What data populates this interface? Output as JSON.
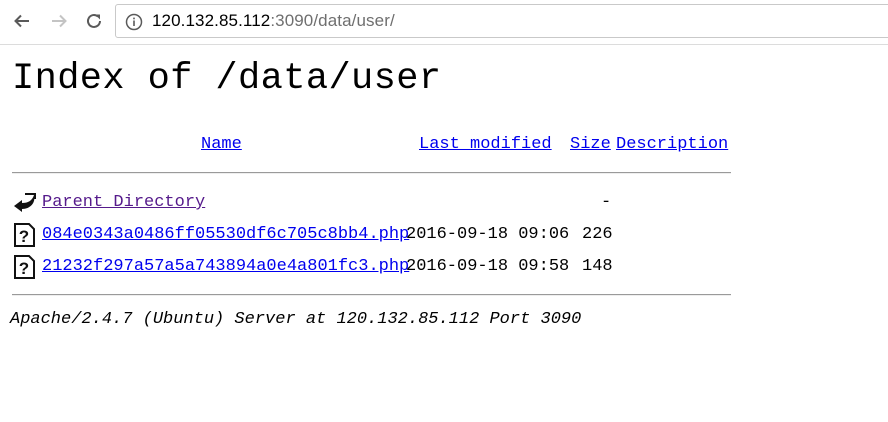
{
  "browser": {
    "url_host": "120.132.85.112",
    "url_rest": ":3090/data/user/"
  },
  "page": {
    "title": "Index of /data/user",
    "columns": {
      "name": "Name",
      "last_modified": "Last modified",
      "size": "Size",
      "description": "Description"
    },
    "parent": {
      "name": "Parent Directory",
      "size": "-"
    },
    "files": [
      {
        "name": "084e0343a0486ff05530df6c705c8bb4.php",
        "modified": "2016-09-18 09:06",
        "size": "226"
      },
      {
        "name": "21232f297a57a5a743894a0e4a801fc3.php",
        "modified": "2016-09-18 09:58",
        "size": "148"
      }
    ],
    "server_signature": "Apache/2.4.7 (Ubuntu) Server at 120.132.85.112 Port 3090"
  }
}
